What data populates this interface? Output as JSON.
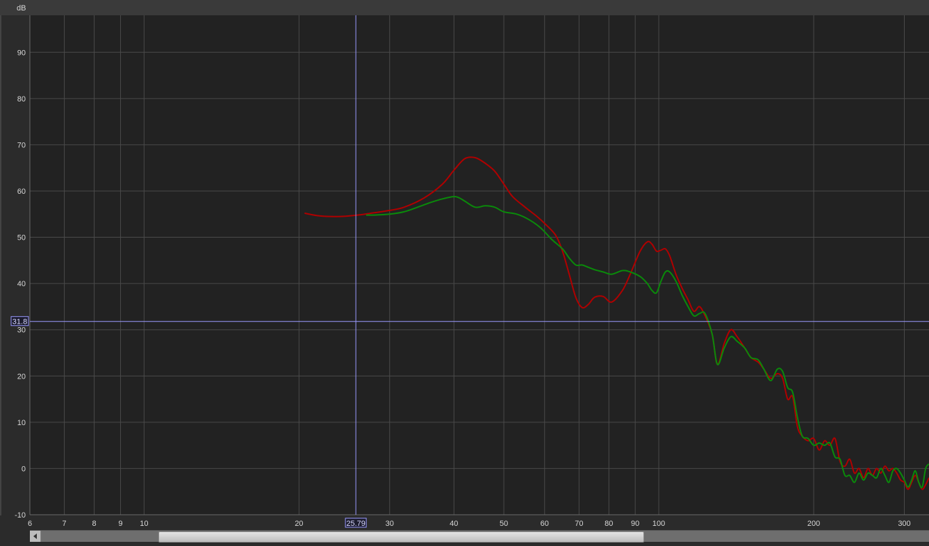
{
  "chart_data": {
    "type": "line",
    "x_scale": "log",
    "xlim": [
      6,
      335
    ],
    "ylim": [
      -10,
      98
    ],
    "y_unit": "dB",
    "x_ticks": [
      6,
      7,
      8,
      9,
      10,
      20,
      30,
      40,
      50,
      60,
      70,
      80,
      90,
      100,
      200,
      300
    ],
    "y_ticks": [
      -10,
      0,
      10,
      20,
      30,
      40,
      50,
      60,
      70,
      80,
      90
    ],
    "grid": true,
    "background": "#222222",
    "grid_color": "#4a4a4a",
    "cursor": {
      "x": 25.79,
      "y": 31.8,
      "x_label": "25.79",
      "y_label": "31.8",
      "color": "#9a9aff"
    },
    "series": [
      {
        "color": "#b00000",
        "x": [
          20.5,
          22,
          24,
          26,
          28,
          30,
          32,
          35,
          38,
          40,
          42,
          44,
          46,
          48,
          50,
          52,
          55,
          58,
          60,
          63,
          65,
          67,
          69,
          71,
          73,
          75,
          78,
          81,
          85,
          88,
          92,
          95,
          97,
          99,
          101,
          103,
          105,
          108,
          111,
          114,
          117,
          120,
          123,
          127,
          130,
          134,
          138,
          142,
          147,
          151,
          156,
          160,
          165,
          170,
          174,
          178,
          182,
          186,
          190,
          195,
          200,
          205,
          210,
          215,
          220,
          225,
          230,
          235,
          240,
          245,
          250,
          255,
          260,
          265,
          270,
          275,
          280,
          285,
          290,
          295,
          300,
          305,
          310,
          315,
          320,
          325,
          330,
          335
        ],
        "y": [
          55.2,
          54.6,
          54.5,
          54.8,
          55.3,
          55.8,
          56.5,
          58.5,
          61.5,
          64.5,
          67.0,
          67.2,
          66.0,
          64.3,
          61.5,
          58.8,
          56.5,
          54.5,
          53.0,
          50.5,
          47.0,
          42.0,
          37.0,
          34.8,
          35.5,
          37.0,
          37.2,
          36.0,
          38.5,
          42.0,
          47.0,
          49.0,
          48.5,
          47.0,
          47.2,
          47.5,
          46.0,
          42.0,
          39.0,
          36.5,
          34.0,
          35.0,
          33.0,
          29.0,
          22.5,
          27.0,
          30.0,
          28.5,
          26.0,
          24.0,
          23.0,
          21.5,
          19.5,
          20.5,
          19.5,
          15.0,
          15.5,
          9.0,
          7.0,
          6.0,
          6.5,
          4.0,
          6.0,
          5.0,
          6.5,
          1.5,
          0.5,
          2.0,
          -1.0,
          0.0,
          -2.0,
          0.0,
          -1.5,
          0.0,
          -1.0,
          0.5,
          -0.5,
          0.0,
          -1.0,
          -2.5,
          -3.0,
          -4.5,
          -3.0,
          -1.5,
          -3.0,
          -4.5,
          -3.5,
          -2.0
        ]
      },
      {
        "color": "#0a8a0a",
        "x": [
          27,
          28,
          30,
          32,
          34,
          36,
          38,
          40,
          41,
          42,
          44,
          46,
          48,
          50,
          53,
          56,
          59,
          62,
          65,
          67,
          69,
          71,
          73,
          75,
          78,
          81,
          85,
          88,
          92,
          95,
          97,
          99,
          101,
          103,
          105,
          108,
          111,
          114,
          117,
          120,
          123,
          127,
          130,
          134,
          138,
          142,
          147,
          151,
          156,
          160,
          165,
          170,
          174,
          178,
          182,
          186,
          190,
          195,
          200,
          205,
          210,
          215,
          220,
          225,
          230,
          235,
          240,
          245,
          250,
          255,
          260,
          265,
          270,
          275,
          280,
          285,
          290,
          295,
          300,
          305,
          310,
          315,
          320,
          325,
          330,
          335
        ],
        "y": [
          54.8,
          54.8,
          55.0,
          55.5,
          56.5,
          57.5,
          58.3,
          58.8,
          58.5,
          57.8,
          56.5,
          56.8,
          56.5,
          55.5,
          55.0,
          53.8,
          52.0,
          49.5,
          47.5,
          45.5,
          44.0,
          44.0,
          43.5,
          43.0,
          42.5,
          42.0,
          42.8,
          42.5,
          41.5,
          40.0,
          38.5,
          38.0,
          40.5,
          42.5,
          42.5,
          40.5,
          37.5,
          35.0,
          33.0,
          33.5,
          33.5,
          29.0,
          22.5,
          26.0,
          28.5,
          27.5,
          26.0,
          24.0,
          23.5,
          21.5,
          19.0,
          21.5,
          21.0,
          17.5,
          16.5,
          11.0,
          7.0,
          6.5,
          5.0,
          5.5,
          5.0,
          5.5,
          2.5,
          2.0,
          -1.5,
          -1.5,
          -3.0,
          -1.0,
          -2.5,
          -1.0,
          -1.5,
          -2.0,
          0.0,
          -1.5,
          -3.0,
          -0.5,
          0.0,
          -1.0,
          -2.5,
          -4.0,
          -2.5,
          -0.5,
          -3.0,
          -4.0,
          0.0,
          1.0
        ]
      }
    ]
  }
}
